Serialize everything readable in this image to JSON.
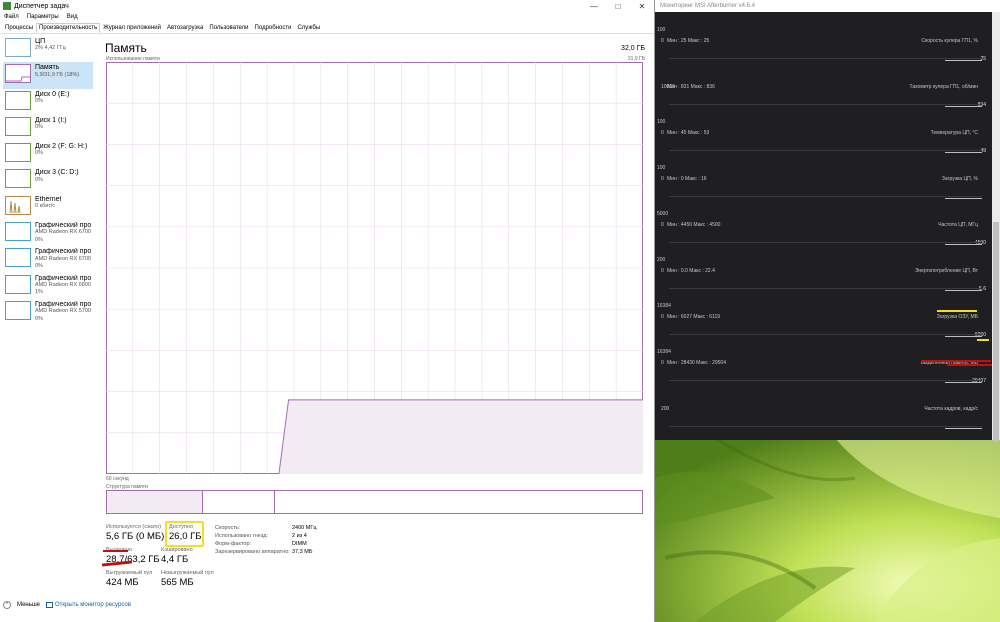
{
  "taskmgr": {
    "title": "Диспетчер задач",
    "menu": [
      "Файл",
      "Параметры",
      "Вид"
    ],
    "tabs": [
      "Процессы",
      "Производительность",
      "Журнал приложений",
      "Автозагрузка",
      "Пользователи",
      "Подробности",
      "Службы"
    ],
    "active_tab": 1,
    "sidebar": [
      {
        "name": "ЦП",
        "line2": "2% 4,42 ГГц",
        "line3": "",
        "kind": "cpu"
      },
      {
        "name": "Память",
        "line2": "5,9/31,9 ГБ (18%)",
        "line3": "",
        "kind": "mem",
        "active": true
      },
      {
        "name": "Диск 0 (E:)",
        "line2": "0%",
        "line3": "",
        "kind": "disk"
      },
      {
        "name": "Диск 1 (I:)",
        "line2": "0%",
        "line3": "",
        "kind": "disk"
      },
      {
        "name": "Диск 2 (F: G: H:)",
        "line2": "0%",
        "line3": "",
        "kind": "disk"
      },
      {
        "name": "Диск 3 (C: D:)",
        "line2": "0%",
        "line3": "",
        "kind": "disk"
      },
      {
        "name": "Ethernet",
        "line2": "0 кбит/с",
        "line3": "",
        "kind": "net"
      },
      {
        "name": "Графический про",
        "line2": "AMD Radeon RX 6700 X",
        "line3": "0%",
        "kind": "gpu"
      },
      {
        "name": "Графический про",
        "line2": "AMD Radeon RX 6700 X",
        "line3": "0%",
        "kind": "gpu"
      },
      {
        "name": "Графический про",
        "line2": "AMD Radeon RX 6800",
        "line3": "1%",
        "kind": "gpu"
      },
      {
        "name": "Графический про",
        "line2": "AMD Radeon RX 5700",
        "line3": "0%",
        "kind": "gpu"
      }
    ],
    "memory": {
      "title": "Память",
      "total": "32,0 ГБ",
      "usage_label": "Использование памяти",
      "usage_max": "31,9 ГБ",
      "axis_left": "60 секунд",
      "structure_label": "Структура памяти",
      "used_label": "Используется (сжато)",
      "used_value": "5,6 ГБ (0 МБ)",
      "available_label": "Доступно",
      "available_value": "26,0 ГБ",
      "committed_label": "Выделено",
      "committed_value": "28,7/63,2 ГБ",
      "cached_label": "Кэшировано",
      "cached_value": "4,4 ГБ",
      "paged_label": "Выгружаемый пул",
      "paged_value": "424 МБ",
      "nonpaged_label": "Невыгружаемый пул",
      "nonpaged_value": "565 МБ",
      "speed_label": "Скорость:",
      "speed_value": "2400 МГц",
      "slots_label": "Использовано гнезд:",
      "slots_value": "2 из 4",
      "form_label": "Форм-фактор:",
      "form_value": "DIMM",
      "reserved_label": "Зарезервировано аппаратно:",
      "reserved_value": "37,3 МБ",
      "usage_fraction_after_jump": 0.18
    },
    "footer": {
      "less": "Меньше",
      "monitor": "Открыть монитор ресурсов"
    }
  },
  "afterburner": {
    "title": "Мониторинг MSI Afterburner v4.6.4",
    "graphs": [
      {
        "top_label": "0",
        "minmax": "Мин : 25  Макс : 25",
        "name": "Скорость кулера ГП1, %",
        "value": "25",
        "scale": "100"
      },
      {
        "top_label": "10000",
        "minmax": "Мин : 831  Макс : 836",
        "name": "Тахометр кулера ГП1, об/мин",
        "value": "834",
        "scale": ""
      },
      {
        "top_label": "0",
        "minmax": "Мин : 45  Макс : 53",
        "name": "Температура ЦП, °C",
        "value": "49",
        "scale": "100"
      },
      {
        "top_label": "0",
        "minmax": "Мин : 0  Макс : 16",
        "name": "Загрузка ЦП, %",
        "value": "",
        "scale": "100"
      },
      {
        "top_label": "0",
        "minmax": "Мин : 4450  Макс : 4500",
        "name": "Частота ЦП, МГц",
        "value": "4500",
        "scale": "5000"
      },
      {
        "top_label": "0",
        "minmax": "Мин : 0.0  Макс : 22.4",
        "name": "Энергопотребление ЦП, Вт",
        "value": "5.6",
        "scale": "200"
      },
      {
        "top_label": "0",
        "minmax": "Мин : 6027  Макс : 6119",
        "name": "Загрузка ОЗУ, МБ",
        "value": "6060",
        "scale": "16384"
      },
      {
        "top_label": "0",
        "minmax": "Мин : 28430  Макс : 29504",
        "name": "Выделенная память, МБ",
        "value": "29407",
        "scale": "16384"
      },
      {
        "top_label": "200",
        "minmax": "",
        "name": "Частота кадров, кадр/с",
        "value": "",
        "scale": ""
      }
    ]
  }
}
